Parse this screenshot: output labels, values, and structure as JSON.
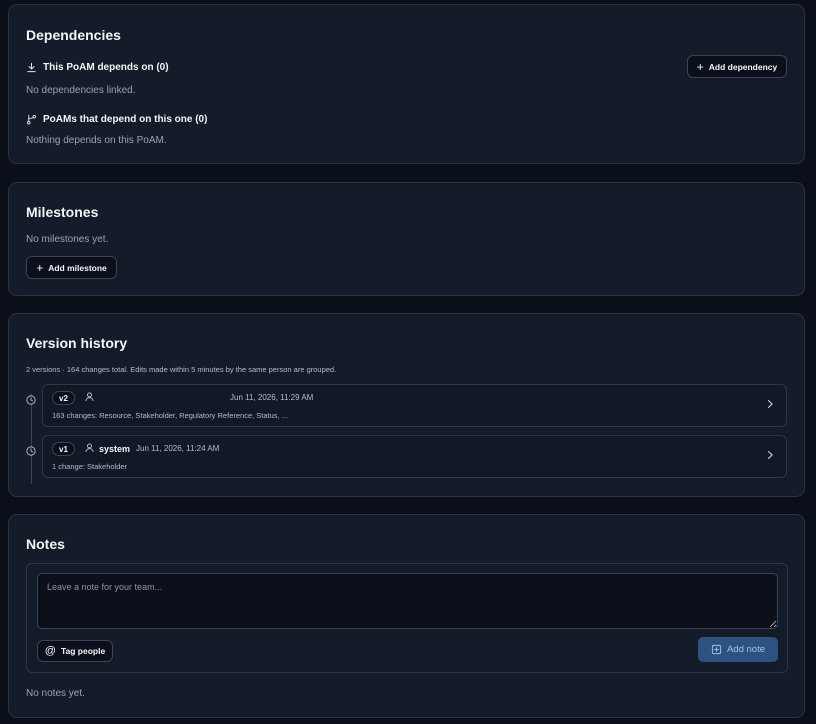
{
  "dependencies": {
    "title": "Dependencies",
    "depends_on_heading": "This PoAM depends on (0)",
    "add_dependency_label": "Add dependency",
    "depends_on_empty": "No dependencies linked.",
    "dependents_heading": "PoAMs that depend on this one (0)",
    "dependents_empty": "Nothing depends on this PoAM."
  },
  "milestones": {
    "title": "Milestones",
    "empty": "No milestones yet.",
    "add_label": "Add milestone"
  },
  "version_history": {
    "title": "Version history",
    "summary": "2 versions · 164 changes total. Edits made within 5 minutes by the same person are grouped.",
    "versions": [
      {
        "badge": "v2",
        "author": "",
        "date": "Jun 11, 2026, 11:29 AM",
        "changes": "163 changes: Resource, Stakeholder, Regulatory Reference, Status, ..."
      },
      {
        "badge": "v1",
        "author": "system",
        "date": "Jun 11, 2026, 11:24 AM",
        "changes": "1 change: Stakeholder"
      }
    ]
  },
  "notes": {
    "title": "Notes",
    "placeholder": "Leave a note for your team...",
    "tag_people_label": "Tag people",
    "add_note_label": "Add note",
    "empty": "No notes yet."
  },
  "colors": {
    "background": "#0a0f19",
    "card": "#141b29",
    "border": "#2a3344",
    "primary_button": "#2c5282"
  },
  "icons": [
    "download-icon",
    "branch-icon",
    "plus-icon",
    "history-icon",
    "user-icon",
    "chevron-right-icon",
    "at-icon",
    "message-plus-icon"
  ]
}
